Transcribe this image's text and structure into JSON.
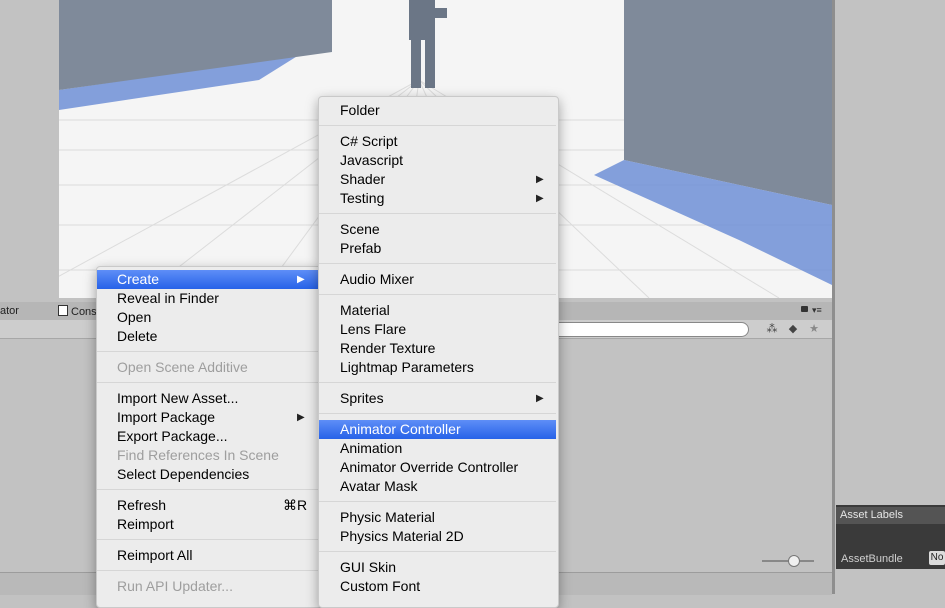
{
  "editor": {
    "left_tab_fragment": "ator",
    "console_tab_fragment": "Cons",
    "console_icon": "console-icon",
    "lock_icon": "lock-icon",
    "menu_icon": "menu-lines-icon",
    "filter_icons": [
      "filter-by-type-icon",
      "filter-by-label-icon",
      "favorite-star-icon"
    ],
    "asset_labels_title": "Asset Labels",
    "asset_bundle_label": "AssetBundle",
    "asset_bundle_value": "No"
  },
  "context_menu": {
    "items": [
      {
        "label": "Create",
        "submenu": true,
        "highlighted": true
      },
      {
        "label": "Reveal in Finder"
      },
      {
        "label": "Open"
      },
      {
        "label": "Delete"
      },
      {
        "separator": true
      },
      {
        "label": "Open Scene Additive",
        "disabled": true
      },
      {
        "separator": true
      },
      {
        "label": "Import New Asset..."
      },
      {
        "label": "Import Package",
        "submenu": true
      },
      {
        "label": "Export Package..."
      },
      {
        "label": "Find References In Scene",
        "disabled": true
      },
      {
        "label": "Select Dependencies"
      },
      {
        "separator": true
      },
      {
        "label": "Refresh",
        "shortcut": "⌘R"
      },
      {
        "label": "Reimport"
      },
      {
        "separator": true
      },
      {
        "label": "Reimport All"
      },
      {
        "separator": true
      },
      {
        "label": "Run API Updater...",
        "disabled": true
      }
    ]
  },
  "create_submenu": {
    "items": [
      {
        "label": "Folder"
      },
      {
        "separator": true
      },
      {
        "label": "C# Script"
      },
      {
        "label": "Javascript"
      },
      {
        "label": "Shader",
        "submenu": true
      },
      {
        "label": "Testing",
        "submenu": true
      },
      {
        "separator": true
      },
      {
        "label": "Scene"
      },
      {
        "label": "Prefab"
      },
      {
        "separator": true
      },
      {
        "label": "Audio Mixer"
      },
      {
        "separator": true
      },
      {
        "label": "Material"
      },
      {
        "label": "Lens Flare"
      },
      {
        "label": "Render Texture"
      },
      {
        "label": "Lightmap Parameters"
      },
      {
        "separator": true
      },
      {
        "label": "Sprites",
        "submenu": true
      },
      {
        "separator": true
      },
      {
        "label": "Animator Controller",
        "highlighted": true
      },
      {
        "label": "Animation"
      },
      {
        "label": "Animator Override Controller"
      },
      {
        "label": "Avatar Mask"
      },
      {
        "separator": true
      },
      {
        "label": "Physic Material"
      },
      {
        "label": "Physics Material 2D"
      },
      {
        "separator": true
      },
      {
        "label": "GUI Skin"
      },
      {
        "label": "Custom Font"
      }
    ]
  },
  "colors": {
    "highlight_top": "#5e8ef7",
    "highlight_bottom": "#2762e8",
    "menu_bg": "#ececec",
    "scene_wall": "#7f8a9a",
    "scene_shadow": "#6f8fd6"
  }
}
